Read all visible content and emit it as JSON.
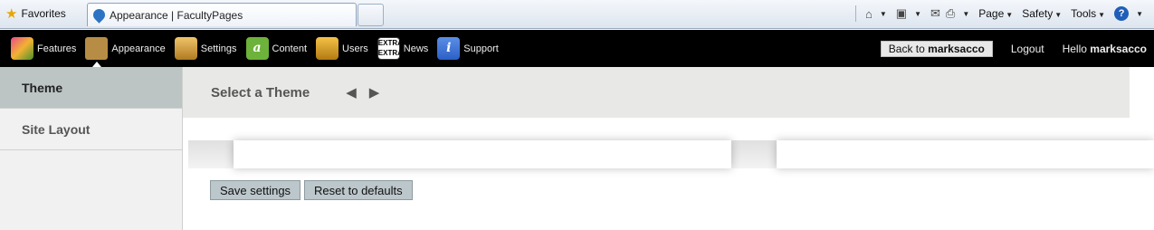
{
  "browser": {
    "favorites_label": "Favorites",
    "tab_title": "Appearance | FacultyPages",
    "tools": {
      "page_label": "Page",
      "safety_label": "Safety",
      "tools_label": "Tools"
    }
  },
  "appbar": {
    "nav": [
      {
        "label": "Features",
        "icon": "puzzle-icon"
      },
      {
        "label": "Appearance",
        "icon": "mona-lisa-icon"
      },
      {
        "label": "Settings",
        "icon": "switch-icon"
      },
      {
        "label": "Content",
        "icon": "letter-a-icon",
        "glyph": "a"
      },
      {
        "label": "Users",
        "icon": "users-icon"
      },
      {
        "label": "News",
        "icon": "newspaper-icon",
        "glyph": "EXTRA EXTRA"
      },
      {
        "label": "Support",
        "icon": "info-icon",
        "glyph": "i"
      }
    ],
    "back_prefix": "Back to",
    "back_user": "marksacco",
    "logout_label": "Logout",
    "hello_prefix": "Hello",
    "hello_user": "marksacco"
  },
  "sidebar": {
    "items": [
      {
        "label": "Theme",
        "active": true
      },
      {
        "label": "Site Layout",
        "active": false
      }
    ]
  },
  "main": {
    "theme_title": "Select a Theme",
    "save_label": "Save settings",
    "reset_label": "Reset to defaults"
  }
}
